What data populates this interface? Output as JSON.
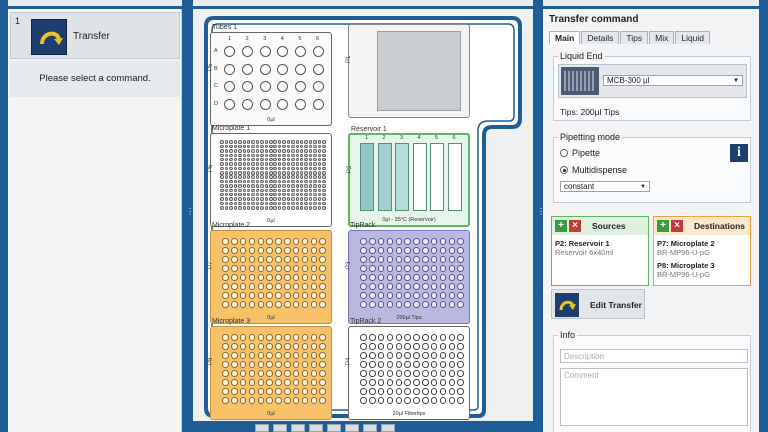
{
  "commands": {
    "items": [
      {
        "number": "1",
        "label": "Transfer"
      }
    ],
    "hint": "Please select a command."
  },
  "deck": {
    "slots": [
      {
        "id": "P5",
        "name": "Tubes 1",
        "caption": "0µl",
        "row_labels": [
          "A",
          "B",
          "C",
          "D"
        ],
        "col_labels": [
          "1",
          "2",
          "3",
          "4",
          "5",
          "6"
        ],
        "kind": "tubes"
      },
      {
        "id": "P1",
        "name": "",
        "caption": "",
        "kind": "empty"
      },
      {
        "id": "P6",
        "name": "Microplate 1",
        "caption": "0µl",
        "kind": "plate384"
      },
      {
        "id": "P2",
        "name": "Reservoir 1",
        "caption": "0µl - 35°C (Reservoir)",
        "col_labels": [
          "1",
          "2",
          "3",
          "4",
          "5",
          "6"
        ],
        "kind": "reservoir"
      },
      {
        "id": "P7",
        "name": "Microplate 2",
        "caption": "0µl",
        "kind": "plate96-orange"
      },
      {
        "id": "P3",
        "name": "TipRack",
        "caption": "200µl Tips",
        "kind": "tips-purple"
      },
      {
        "id": "P8",
        "name": "Microplate 3",
        "caption": "0µl",
        "kind": "plate96-orange"
      },
      {
        "id": "P4",
        "name": "TipRack 2",
        "caption": "20µl Filtertips",
        "kind": "tips-white"
      }
    ]
  },
  "transfer": {
    "title": "Transfer command",
    "tabs": [
      "Main",
      "Details",
      "Tips",
      "Mix",
      "Liquid"
    ],
    "liquid_end": {
      "group_title": "Liquid End",
      "selected": "MCB-300 µl",
      "tips_text": "Tips: 200µl Tips"
    },
    "pipetting": {
      "group_title": "Pipetting mode",
      "options": [
        "Pipette",
        "Multidispense"
      ],
      "selected_option": "Multidispense",
      "mode_select": "constant",
      "info_label": "i"
    },
    "sources": {
      "title": "Sources",
      "entries": [
        {
          "name": "P2: Reservoir 1",
          "type": "Reservoir 6x40ml"
        }
      ]
    },
    "destinations": {
      "title": "Destinations",
      "entries": [
        {
          "name": "P7: Microplate 2",
          "type": "BR-MP96-U-pG"
        },
        {
          "name": "P8: Microplate 3",
          "type": "BR-MP96-U-pG"
        }
      ]
    },
    "edit_button": "Edit Transfer",
    "info": {
      "group_title": "Info",
      "description_placeholder": "Description",
      "comment_placeholder": "Comment"
    }
  },
  "colors": {
    "frame": "#1f5d96",
    "accent_dark": "#1c3f70",
    "source_green": "#5cb85c",
    "dest_orange": "#f0a040",
    "plate_orange": "#f7c16a",
    "tips_purple": "#b9b8e0",
    "reservoir_green": "#a9dcb9"
  }
}
